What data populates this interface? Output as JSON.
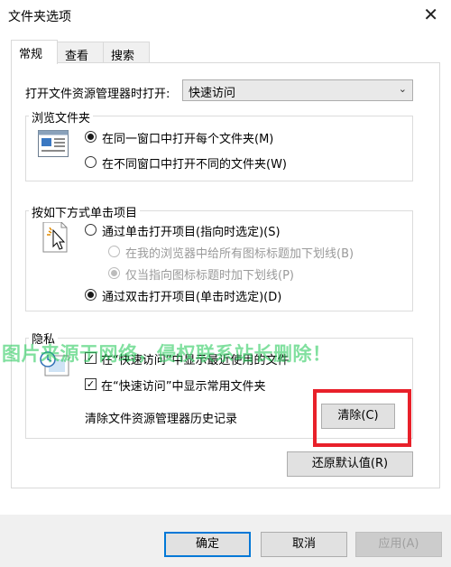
{
  "window": {
    "title": "文件夹选项",
    "close_glyph": "✕"
  },
  "tabs": [
    {
      "label": "常规"
    },
    {
      "label": "查看"
    },
    {
      "label": "搜索"
    }
  ],
  "open_explorer": {
    "label": "打开文件资源管理器时打开:",
    "selected": "快速访问"
  },
  "browse_folders": {
    "title": "浏览文件夹",
    "options": [
      {
        "label": "在同一窗口中打开每个文件夹(M)",
        "checked": true
      },
      {
        "label": "在不同窗口中打开不同的文件夹(W)",
        "checked": false
      }
    ]
  },
  "click_items": {
    "title": "按如下方式单击项目",
    "single": "通过单击打开项目(指向时选定)(S)",
    "underline_all": "在我的浏览器中给所有图标标题加下划线(B)",
    "underline_point": "仅当指向图标标题时加下划线(P)",
    "double": "通过双击打开项目(单击时选定)(D)"
  },
  "privacy": {
    "title": "隐私",
    "recent_files": "在“快速访问”中显示最近使用的文件",
    "frequent_folders": "在“快速访问”中显示常用文件夹",
    "clear_label": "清除文件资源管理器历史记录",
    "clear_button": "清除(C)"
  },
  "restore_defaults": "还原默认值(R)",
  "watermark": "图片来源于网络，侵权联系站长删除！",
  "footer": {
    "ok": "确定",
    "cancel": "取消",
    "apply": "应用(A)"
  },
  "colors": {
    "accent": "#0078d7",
    "highlight_box": "#e8202a",
    "watermark": "#2ecc60"
  }
}
